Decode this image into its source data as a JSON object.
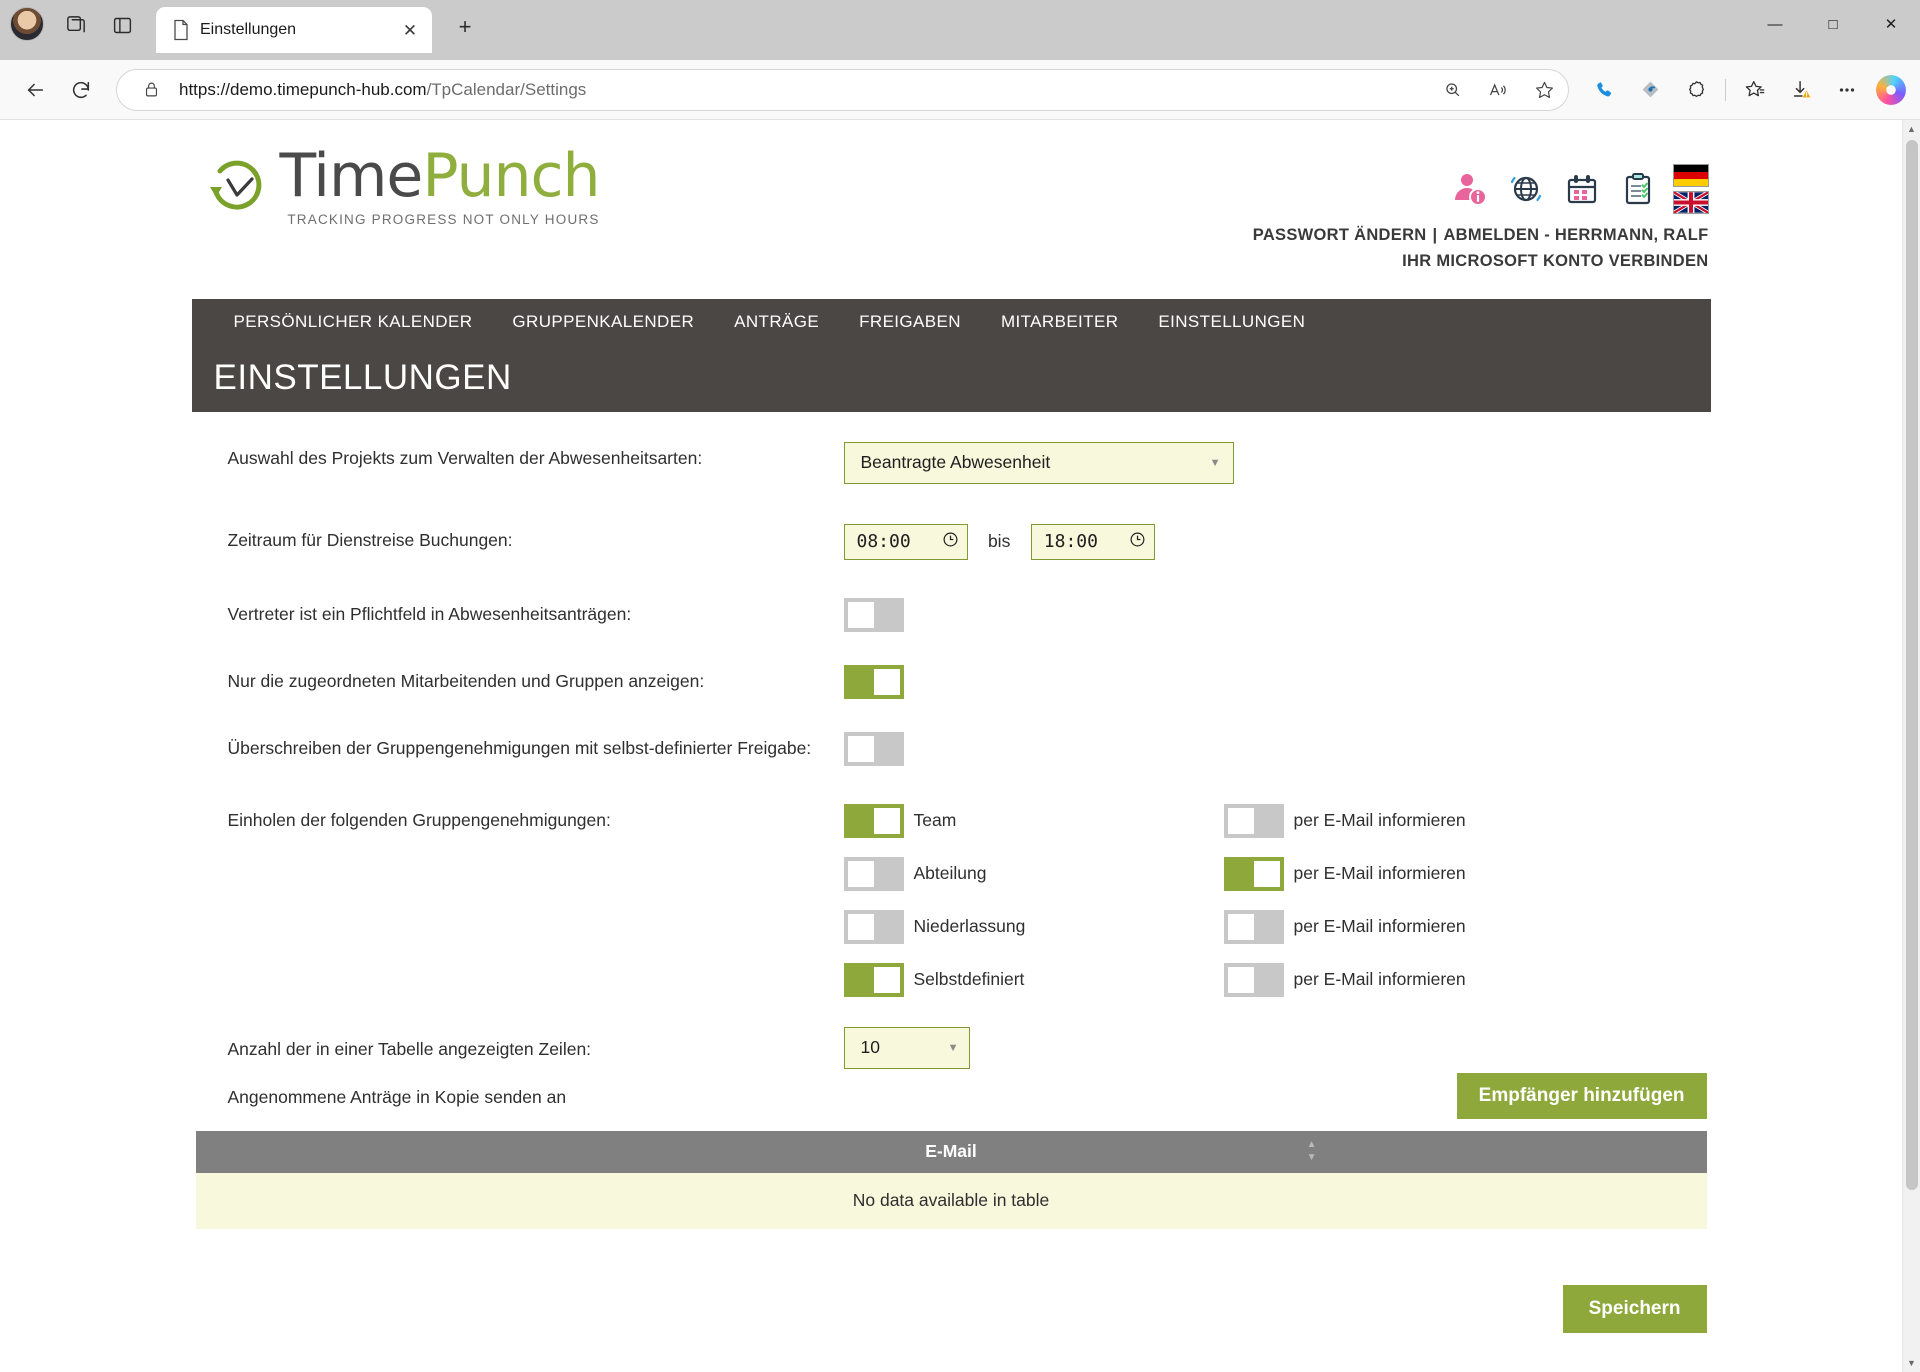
{
  "browser": {
    "tab": {
      "title": "Einstellungen",
      "favicon_icon": "page-icon",
      "close_icon": "close-icon"
    },
    "newtab_icon": "plus-icon",
    "left_icons": [
      "profile-avatar",
      "tab-collections-icon",
      "split-screen-icon"
    ],
    "nav": {
      "back_icon": "back-arrow-icon",
      "reload_icon": "reload-icon"
    },
    "omnibox": {
      "lock_icon": "lock-icon",
      "url_dark": "https://demo.timepunch-hub.com",
      "url_dim": "/TpCalendar/Settings",
      "inline_icons": [
        "zoom-icon",
        "read-aloud-icon",
        "favorite-star-icon"
      ]
    },
    "toolbar_icons": [
      "phone-link-icon",
      "split-tab-icon",
      "extensions-icon",
      "collections-icon",
      "downloads-icon",
      "more-options-icon",
      "copilot-icon"
    ],
    "window_controls": {
      "minimize": "—",
      "maximize": "□",
      "close": "✕"
    }
  },
  "site": {
    "logo": {
      "clock_icon": "timepunch-clock-logo",
      "word1": "Time",
      "word2": "Punch",
      "tagline": "TRACKING PROGRESS NOT ONLY HOURS"
    },
    "header_icons": [
      "user-info-icon",
      "globe-sync-icon",
      "calendar-icon",
      "clipboard-checklist-icon"
    ],
    "flags": [
      "flag-de-icon",
      "flag-uk-icon"
    ],
    "links": {
      "change_password": "PASSWORT ÄNDERN",
      "separator": "|",
      "logout": "ABMELDEN - HERRMANN, RALF",
      "connect_microsoft": "IHR MICROSOFT KONTO VERBINDEN"
    },
    "nav_items": [
      "PERSÖNLICHER KALENDER",
      "GRUPPENKALENDER",
      "ANTRÄGE",
      "FREIGABEN",
      "MITARBEITER",
      "EINSTELLUNGEN"
    ],
    "page_title": "EINSTELLUNGEN"
  },
  "settings": {
    "project_select": {
      "label": "Auswahl des Projekts zum Verwalten der Abwesenheitsarten:",
      "value": "Beantragte Abwesenheit",
      "caret_icon": "chevron-down-icon"
    },
    "business_trip": {
      "label": "Zeitraum für Dienstreise Buchungen:",
      "from": "08:00",
      "to": "18:00",
      "between_word": "bis",
      "clock_icon": "clock-icon"
    },
    "toggles": [
      {
        "label": "Vertreter ist ein Pflichtfeld in Abwesenheitsanträgen:",
        "state": "off"
      },
      {
        "label": "Nur die zugeordneten Mitarbeitenden und Gruppen anzeigen:",
        "state": "on"
      },
      {
        "label": "Überschreiben der Gruppengenehmigungen mit selbst-definierter Freigabe:",
        "state": "off"
      }
    ],
    "group_approvals": {
      "label": "Einholen der folgenden Gruppengenehmigungen:",
      "email_label": "per E-Mail informieren",
      "rows": [
        {
          "name": "Team",
          "enabled": "on",
          "email": "off"
        },
        {
          "name": "Abteilung",
          "enabled": "off",
          "email": "on"
        },
        {
          "name": "Niederlassung",
          "enabled": "off",
          "email": "off"
        },
        {
          "name": "Selbstdefiniert",
          "enabled": "on",
          "email": "off"
        }
      ]
    },
    "rows_per_table": {
      "label": "Anzahl der in einer Tabelle angezeigten Zeilen:",
      "value": "10",
      "caret_icon": "chevron-down-icon"
    },
    "copy_recipients": {
      "label": "Angenommene Anträge in Kopie senden an",
      "add_button": "Empfänger hinzufügen"
    },
    "table": {
      "column_header": "E-Mail",
      "sort_icon": "sort-arrows-icon",
      "empty_message": "No data available in table"
    },
    "save_button": "Speichern"
  },
  "colors": {
    "brand_green": "#8fa83c",
    "logo_grey": "#4a4a4a",
    "nav_bar": "#4a4744",
    "field_bg": "#f7f8dc",
    "field_border": "#7f9a33",
    "toggle_off": "#c8c8c8",
    "table_header": "#808080"
  }
}
